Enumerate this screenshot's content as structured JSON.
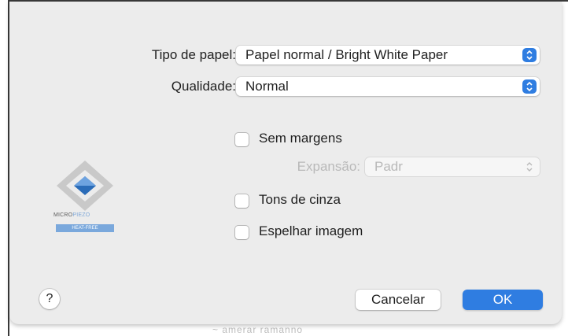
{
  "dialog": {
    "paper_type": {
      "label": "Tipo de papel:",
      "value": "Papel normal / Bright White Paper"
    },
    "quality": {
      "label": "Qualidade:",
      "value": "Normal"
    },
    "borderless": {
      "label": "Sem margens",
      "checked": false
    },
    "expansion": {
      "label": "Expansão:",
      "value": "Padr",
      "enabled": false
    },
    "grayscale": {
      "label": "Tons de cinza",
      "checked": false
    },
    "mirror": {
      "label": "Espelhar imagem",
      "checked": false
    },
    "logo": {
      "brand_a": "MICRO",
      "brand_b": "PIEZO",
      "tag": "HEAT-FREE"
    },
    "help_label": "?",
    "cancel_label": "Cancelar",
    "ok_label": "OK"
  },
  "behind_text": "~ amerar ramanno",
  "colors": {
    "accent": "#2f7de1",
    "dialog_bg": "#ececec",
    "disabled_text": "#b9b9b9"
  }
}
